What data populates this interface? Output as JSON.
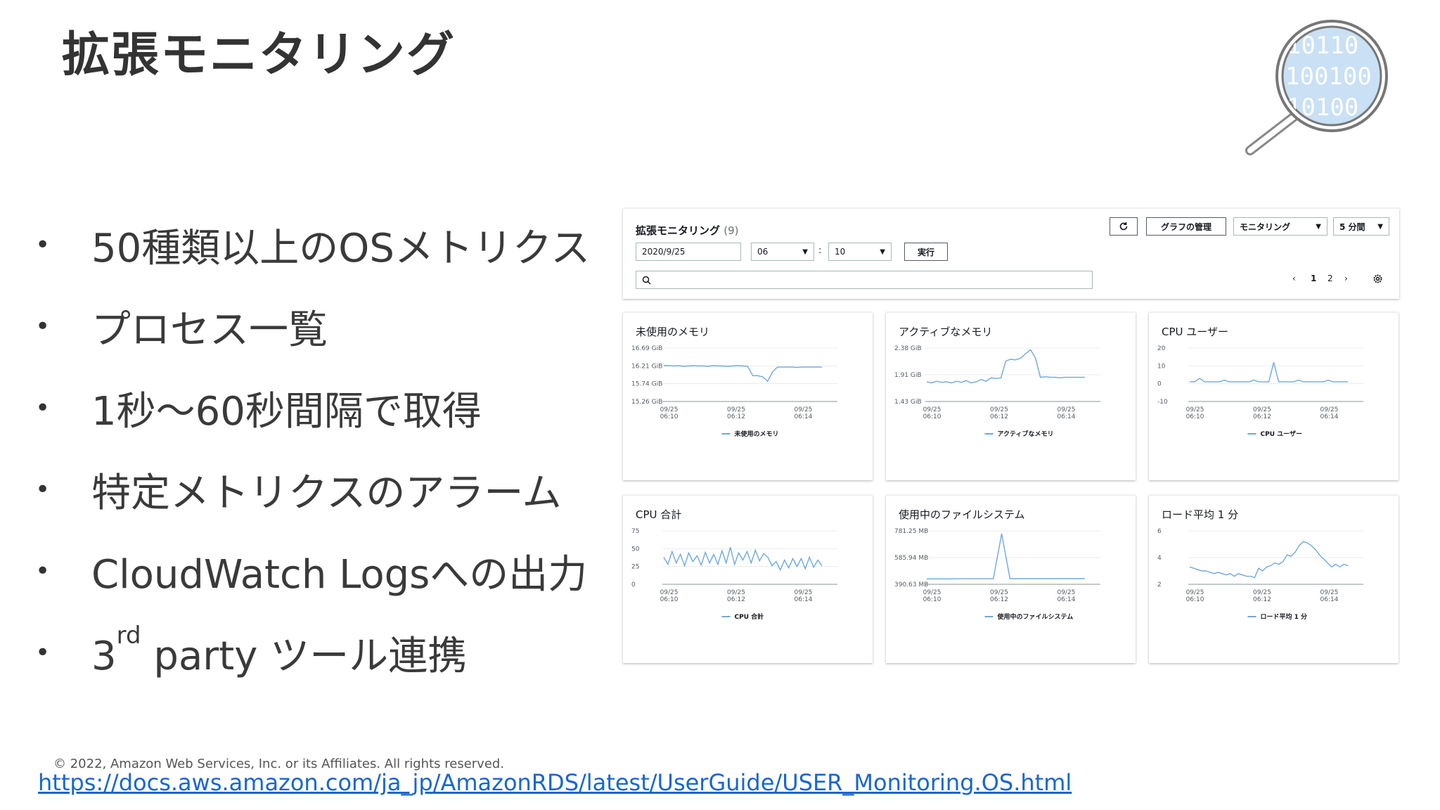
{
  "slide": {
    "title": "拡張モニタリング",
    "bullets": [
      {
        "text": "50種類以上のOSメトリクス"
      },
      {
        "text": "プロセス一覧"
      },
      {
        "text": "1秒〜60秒間隔で取得"
      },
      {
        "text": "特定メトリクスのアラーム"
      },
      {
        "text": "CloudWatch Logsへの出力"
      },
      {
        "pre": "3",
        "sup": "rd",
        "post": " party ツール連携"
      }
    ],
    "magnifier_digits": [
      "10110",
      "100100",
      "10100"
    ],
    "copyright": "© 2022, Amazon Web Services, Inc. or its Affiliates. All rights reserved.",
    "link": "https://docs.aws.amazon.com/ja_jp/AmazonRDS/latest/UserGuide/USER_Monitoring.OS.html"
  },
  "console": {
    "title": "拡張モニタリング",
    "count": "(9)",
    "refresh_icon": "refresh-icon",
    "manage_graphs": "グラフの管理",
    "monitoring_dropdown": "モニタリング",
    "period_dropdown": "5 分間",
    "date_value": "2020/9/25",
    "hour_value": "06",
    "minute_value": "10",
    "run_button": "実行",
    "colon": ":",
    "search_placeholder": "",
    "pager": {
      "prev": "‹",
      "page1": "1",
      "page2": "2",
      "next": "›"
    },
    "line_color": "#6fa8dc"
  },
  "chart_data": [
    {
      "type": "line",
      "title": "未使用のメモリ",
      "ytick_labels": [
        "16.69 GiB",
        "16.21 GiB",
        "15.74 GiB",
        "15.26 GiB"
      ],
      "ylim": [
        15.26,
        16.69
      ],
      "xtick_labels": [
        [
          "09/25",
          "06:10"
        ],
        [
          "09/25",
          "06:12"
        ],
        [
          "09/25",
          "06:14"
        ]
      ],
      "series": [
        {
          "name": "未使用のメモリ",
          "values": [
            16.22,
            16.22,
            16.21,
            16.22,
            16.2,
            16.21,
            16.22,
            16.21,
            16.21,
            16.2,
            16.22,
            16.21,
            16.21,
            16.2,
            16.21,
            16.22,
            16.21,
            16.2,
            15.95,
            15.95,
            15.92,
            15.8,
            16.05,
            16.18,
            16.18,
            16.18,
            16.18,
            16.17,
            16.18,
            16.18,
            16.18,
            16.18,
            16.18
          ]
        }
      ]
    },
    {
      "type": "line",
      "title": "アクティブなメモリ",
      "ytick_labels": [
        "2.38 GiB",
        "1.91 GiB",
        "1.43 GiB"
      ],
      "ylim": [
        1.43,
        2.38
      ],
      "xtick_labels": [
        [
          "09/25",
          "06:10"
        ],
        [
          "09/25",
          "06:12"
        ],
        [
          "09/25",
          "06:14"
        ]
      ],
      "series": [
        {
          "name": "アクティブなメモリ",
          "values": [
            1.78,
            1.76,
            1.79,
            1.77,
            1.78,
            1.76,
            1.79,
            1.77,
            1.8,
            1.76,
            1.78,
            1.82,
            1.79,
            1.85,
            1.84,
            1.85,
            2.15,
            2.18,
            2.17,
            2.2,
            2.28,
            2.35,
            2.2,
            1.86,
            1.87,
            1.86,
            1.86,
            1.85,
            1.86,
            1.86,
            1.86,
            1.86,
            1.86
          ]
        }
      ]
    },
    {
      "type": "line",
      "title": "CPU ユーザー",
      "ytick_labels": [
        "20",
        "10",
        "0",
        "-10"
      ],
      "ylim": [
        -10,
        20
      ],
      "xtick_labels": [
        [
          "09/25",
          "06:10"
        ],
        [
          "09/25",
          "06:12"
        ],
        [
          "09/25",
          "06:14"
        ]
      ],
      "series": [
        {
          "name": "CPU ユーザー",
          "values": [
            1,
            1,
            3,
            1,
            1,
            1,
            1,
            2,
            1,
            1,
            1,
            1,
            1,
            2,
            1,
            1,
            1,
            12,
            1,
            1,
            1,
            1,
            2,
            1,
            1,
            1,
            1,
            1,
            2,
            1,
            1,
            1,
            1
          ]
        }
      ]
    },
    {
      "type": "line",
      "title": "CPU 合計",
      "ytick_labels": [
        "75",
        "50",
        "25",
        "0"
      ],
      "ylim": [
        0,
        75
      ],
      "xtick_labels": [
        [
          "09/25",
          "06:10"
        ],
        [
          "09/25",
          "06:12"
        ],
        [
          "09/25",
          "06:14"
        ]
      ],
      "series": [
        {
          "name": "CPU 合計",
          "values": [
            38,
            28,
            46,
            30,
            42,
            26,
            44,
            32,
            40,
            27,
            45,
            30,
            42,
            28,
            47,
            30,
            52,
            28,
            44,
            34,
            46,
            30,
            48,
            33,
            43,
            38,
            26,
            32,
            20,
            34,
            23,
            36,
            25,
            36,
            22,
            38,
            24,
            34,
            26
          ]
        }
      ]
    },
    {
      "type": "line",
      "title": "使用中のファイルシステム",
      "ytick_labels": [
        "781.25 MB",
        "585.94 MB",
        "390.63 MB"
      ],
      "ylim": [
        390.63,
        781.25
      ],
      "xtick_labels": [
        [
          "09/25",
          "06:10"
        ],
        [
          "09/25",
          "06:12"
        ],
        [
          "09/25",
          "06:14"
        ]
      ],
      "series": [
        {
          "name": "使用中のファイルシステム",
          "values": [
            430,
            430,
            430,
            430,
            431,
            431,
            431,
            431,
            431,
            760,
            432,
            432,
            432,
            432,
            432,
            432,
            432,
            432,
            432,
            432
          ]
        }
      ]
    },
    {
      "type": "line",
      "title": "ロード平均 1 分",
      "ytick_labels": [
        "6",
        "4",
        "2"
      ],
      "ylim": [
        2,
        6
      ],
      "xtick_labels": [
        [
          "09/25",
          "06:10"
        ],
        [
          "09/25",
          "06:12"
        ],
        [
          "09/25",
          "06:14"
        ]
      ],
      "series": [
        {
          "name": "ロード平均 1 分",
          "values": [
            3.3,
            3.2,
            3.1,
            3.0,
            3.0,
            2.9,
            2.8,
            2.9,
            2.8,
            2.7,
            2.8,
            2.6,
            2.8,
            2.7,
            2.6,
            2.6,
            2.5,
            3.2,
            3.0,
            3.3,
            3.4,
            3.6,
            3.5,
            3.7,
            4.2,
            4.1,
            4.4,
            4.9,
            5.2,
            5.1,
            4.9,
            4.6,
            4.2,
            3.9,
            3.6,
            3.3,
            3.5,
            3.3,
            3.5,
            3.4
          ]
        }
      ]
    }
  ]
}
